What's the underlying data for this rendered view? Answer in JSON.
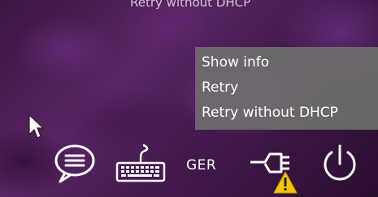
{
  "window": {
    "title_overlay": "Retry without DHCP"
  },
  "context_menu": {
    "items": [
      {
        "label": "Show info"
      },
      {
        "label": "Retry"
      },
      {
        "label": "Retry without DHCP"
      }
    ]
  },
  "taskbar": {
    "language": "GER",
    "icons": [
      "chat-bubble-icon",
      "keyboard-icon",
      "network-warning-icon",
      "power-icon"
    ]
  },
  "colors": {
    "menu_background": "#6e6e6e",
    "menu_text": "#ffffff",
    "warning": "#f5c400"
  }
}
